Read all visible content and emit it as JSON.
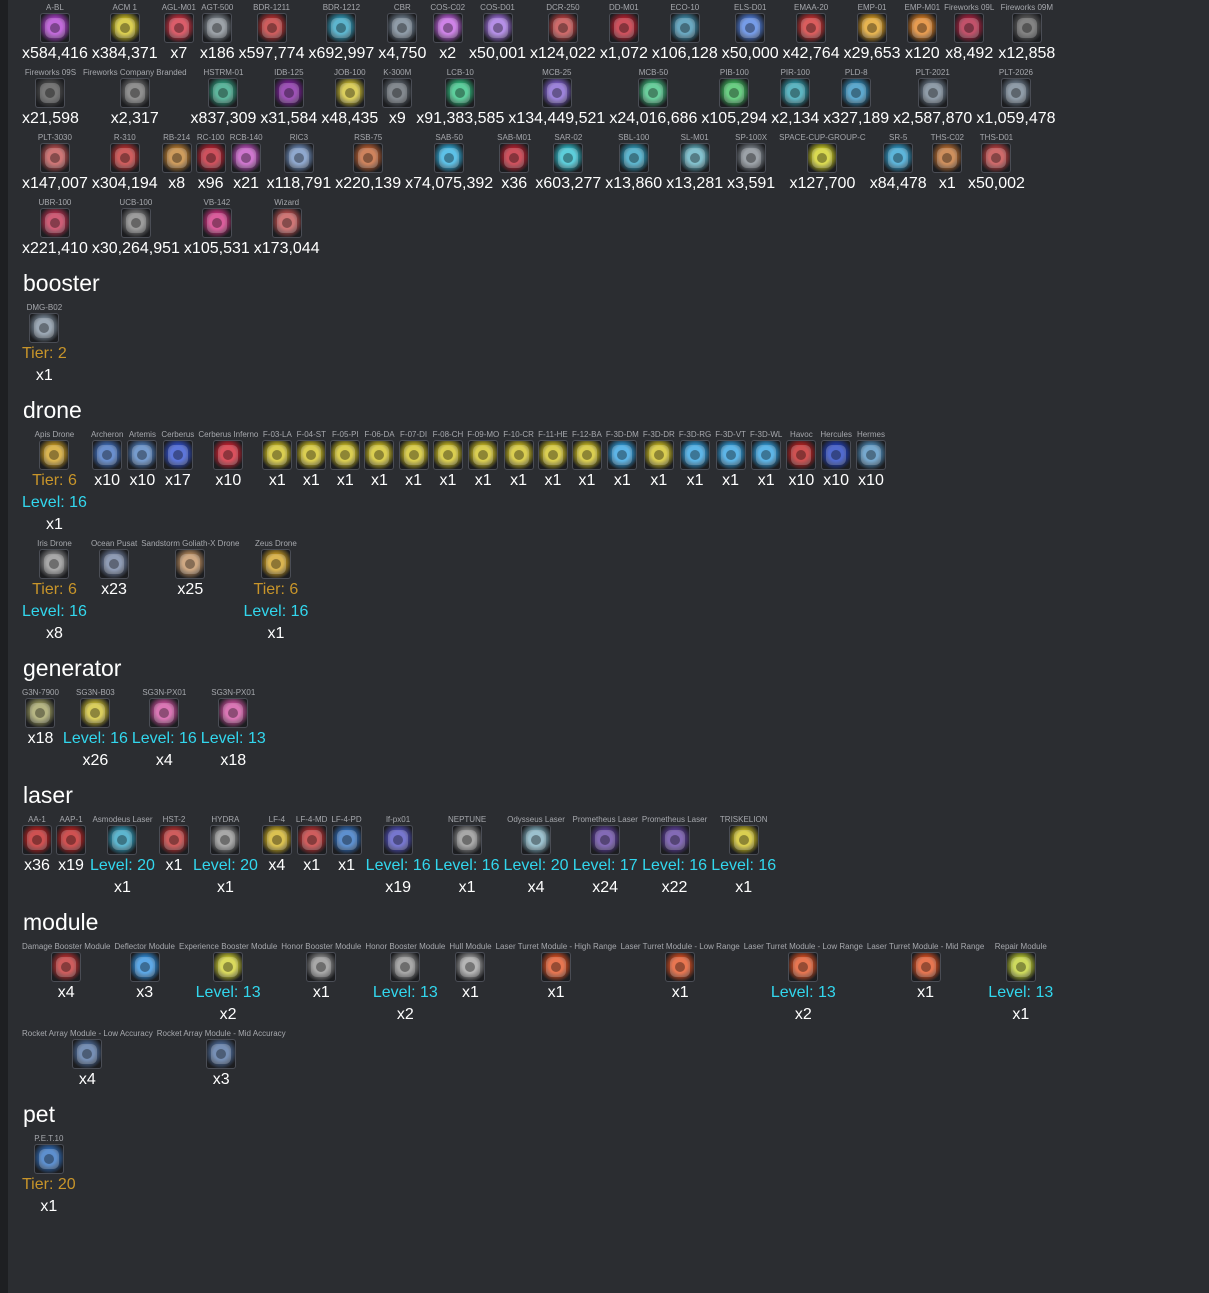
{
  "sections": [
    {
      "heading": "",
      "rows": [
        [
          {
            "name": "A-BL",
            "qty": "x584,416",
            "color": "#b040d0"
          },
          {
            "name": "ACM 1",
            "qty": "x384,371",
            "color": "#d0c020"
          },
          {
            "name": "AGL-M01",
            "qty": "x7",
            "color": "#d03040"
          },
          {
            "name": "AGT-500",
            "qty": "x186",
            "color": "#808890"
          },
          {
            "name": "BDR-1211",
            "qty": "x597,774",
            "color": "#c03030"
          },
          {
            "name": "BDR-1212",
            "qty": "x692,997",
            "color": "#30a0c0"
          },
          {
            "name": "CBR",
            "qty": "x4,750",
            "color": "#708090"
          },
          {
            "name": "COS-C02",
            "qty": "x2",
            "color": "#c060e0"
          },
          {
            "name": "COS-D01",
            "qty": "x50,001",
            "color": "#a070e0"
          },
          {
            "name": "DCR-250",
            "qty": "x124,022",
            "color": "#c04040"
          },
          {
            "name": "DD-M01",
            "qty": "x1,072",
            "color": "#c02030"
          },
          {
            "name": "ECO-10",
            "qty": "x106,128",
            "color": "#4090b0"
          },
          {
            "name": "ELS-D01",
            "qty": "x50,000",
            "color": "#5080e0"
          },
          {
            "name": "EMAA-20",
            "qty": "x42,764",
            "color": "#d03030"
          },
          {
            "name": "EMP-01",
            "qty": "x29,653",
            "color": "#e0a020"
          },
          {
            "name": "EMP-M01",
            "qty": "x120",
            "color": "#e08020"
          },
          {
            "name": "Fireworks 09L",
            "qty": "x8,492",
            "color": "#b02040"
          },
          {
            "name": "Fireworks 09M",
            "qty": "x12,858",
            "color": "#606060"
          }
        ],
        [
          {
            "name": "Fireworks 09S",
            "qty": "x21,598",
            "color": "#505050"
          },
          {
            "name": "Fireworks Company Branded",
            "qty": "x2,317",
            "color": "#707070"
          },
          {
            "name": "HSTRM-01",
            "qty": "x837,309",
            "color": "#30a080"
          },
          {
            "name": "IDB-125",
            "qty": "x31,584",
            "color": "#8020a0"
          },
          {
            "name": "JOB-100",
            "qty": "x48,435",
            "color": "#d0c030"
          },
          {
            "name": "K-300M",
            "qty": "x9",
            "color": "#606870"
          },
          {
            "name": "LCB-10",
            "qty": "x91,383,585",
            "color": "#30c080"
          },
          {
            "name": "MCB-25",
            "qty": "x134,449,521",
            "color": "#8060d0"
          },
          {
            "name": "MCB-50",
            "qty": "x24,016,686",
            "color": "#40c080"
          },
          {
            "name": "PIB-100",
            "qty": "x105,294",
            "color": "#40c060"
          },
          {
            "name": "PIR-100",
            "qty": "x2,134",
            "color": "#30a0b0"
          },
          {
            "name": "PLD-8",
            "qty": "x327,189",
            "color": "#3090c0"
          },
          {
            "name": "PLT-2021",
            "qty": "x2,587,870",
            "color": "#708090"
          },
          {
            "name": "PLT-2026",
            "qty": "x1,059,478",
            "color": "#708090"
          }
        ],
        [
          {
            "name": "PLT-3030",
            "qty": "x147,007",
            "color": "#c05050"
          },
          {
            "name": "R-310",
            "qty": "x304,194",
            "color": "#c03030"
          },
          {
            "name": "RB-214",
            "qty": "x8",
            "color": "#c08030"
          },
          {
            "name": "RC-100",
            "qty": "x96",
            "color": "#c02030"
          },
          {
            "name": "RCB-140",
            "qty": "x21",
            "color": "#c050c0"
          },
          {
            "name": "RIC3",
            "qty": "x118,791",
            "color": "#7090c0"
          },
          {
            "name": "RSB-75",
            "qty": "x220,139",
            "color": "#c06030"
          },
          {
            "name": "SAB-50",
            "qty": "x74,075,392",
            "color": "#30b0e0"
          },
          {
            "name": "SAB-M01",
            "qty": "x36",
            "color": "#c02030"
          },
          {
            "name": "SAR-02",
            "qty": "x603,277",
            "color": "#30c0d0"
          },
          {
            "name": "SBL-100",
            "qty": "x13,860",
            "color": "#30a0c0"
          },
          {
            "name": "SL-M01",
            "qty": "x13,281",
            "color": "#60b0c0"
          },
          {
            "name": "SP-100X",
            "qty": "x3,591",
            "color": "#808890"
          },
          {
            "name": "SPACE-CUP-GROUP-C",
            "qty": "x127,700",
            "color": "#d0d020"
          },
          {
            "name": "SR-5",
            "qty": "x84,478",
            "color": "#30a0d0"
          },
          {
            "name": "THS-C02",
            "qty": "x1",
            "color": "#c07030"
          },
          {
            "name": "THS-D01",
            "qty": "x50,002",
            "color": "#c04040"
          }
        ],
        [
          {
            "name": "UBR-100",
            "qty": "x221,410",
            "color": "#c03050"
          },
          {
            "name": "UCB-100",
            "qty": "x30,264,951",
            "color": "#808080"
          },
          {
            "name": "VB-142",
            "qty": "x105,531",
            "color": "#d03080"
          },
          {
            "name": "Wizard",
            "qty": "x173,044",
            "color": "#c05050"
          }
        ]
      ]
    },
    {
      "heading": "booster",
      "rows": [
        [
          {
            "name": "DMG-B02",
            "tier": "Tier: 2",
            "qty": "x1",
            "color": "#8090a0"
          }
        ]
      ]
    },
    {
      "heading": "drone",
      "rows": [
        [
          {
            "name": "Apis Drone",
            "tier": "Tier: 6",
            "level": "Level: 16",
            "qty": "x1",
            "color": "#d0a020"
          },
          {
            "name": "Archeron",
            "qty": "x10",
            "color": "#4070c0"
          },
          {
            "name": "Artemis",
            "qty": "x10",
            "color": "#5080c0"
          },
          {
            "name": "Cerberus",
            "qty": "x17",
            "color": "#3050d0"
          },
          {
            "name": "Cerberus Inferno",
            "qty": "x10",
            "color": "#d02030"
          },
          {
            "name": "F-03-LA",
            "qty": "x1",
            "color": "#d0c020"
          },
          {
            "name": "F-04-ST",
            "qty": "x1",
            "color": "#d0c020"
          },
          {
            "name": "F-05-PI",
            "qty": "x1",
            "color": "#d0c020"
          },
          {
            "name": "F-06-DA",
            "qty": "x1",
            "color": "#d0c020"
          },
          {
            "name": "F-07-DI",
            "qty": "x1",
            "color": "#d0c020"
          },
          {
            "name": "F-08-CH",
            "qty": "x1",
            "color": "#d0c020"
          },
          {
            "name": "F-09-MO",
            "qty": "x1",
            "color": "#d0c020"
          },
          {
            "name": "F-10-CR",
            "qty": "x1",
            "color": "#d0c020"
          },
          {
            "name": "F-11-HE",
            "qty": "x1",
            "color": "#d0c020"
          },
          {
            "name": "F-12-BA",
            "qty": "x1",
            "color": "#d0c020"
          },
          {
            "name": "F-3D-DM",
            "qty": "x1",
            "color": "#30a0e0"
          },
          {
            "name": "F-3D-DR",
            "qty": "x1",
            "color": "#d0c020"
          },
          {
            "name": "F-3D-RG",
            "qty": "x1",
            "color": "#30a0e0"
          },
          {
            "name": "F-3D-VT",
            "qty": "x1",
            "color": "#30a0e0"
          },
          {
            "name": "F-3D-WL",
            "qty": "x1",
            "color": "#30a0e0"
          },
          {
            "name": "Havoc",
            "qty": "x10",
            "color": "#c02020"
          },
          {
            "name": "Hercules",
            "qty": "x10",
            "color": "#2040c0"
          },
          {
            "name": "Hermes",
            "qty": "x10",
            "color": "#5090c0"
          }
        ],
        [
          {
            "name": "Iris Drone",
            "tier": "Tier: 6",
            "level": "Level: 16",
            "qty": "x8",
            "color": "#909090"
          },
          {
            "name": "Ocean Pusat",
            "qty": "x23",
            "color": "#7080a0"
          },
          {
            "name": "Sandstorm Goliath-X Drone",
            "qty": "x25",
            "color": "#c09060"
          },
          {
            "name": "Zeus Drone",
            "tier": "Tier: 6",
            "level": "Level: 16",
            "qty": "x1",
            "color": "#d0a020"
          }
        ]
      ]
    },
    {
      "heading": "generator",
      "rows": [
        [
          {
            "name": "G3N-7900",
            "qty": "x18",
            "color": "#a0a060"
          },
          {
            "name": "SG3N-B03",
            "level": "Level: 16",
            "qty": "x26",
            "color": "#d0c030"
          },
          {
            "name": "SG3N-PX01",
            "level": "Level: 16",
            "qty": "x4",
            "color": "#d050a0"
          },
          {
            "name": "SG3N-PX01",
            "level": "Level: 13",
            "qty": "x18",
            "color": "#d050a0"
          }
        ]
      ]
    },
    {
      "heading": "laser",
      "rows": [
        [
          {
            "name": "AA-1",
            "qty": "x36",
            "color": "#c02020"
          },
          {
            "name": "AAP-1",
            "qty": "x19",
            "color": "#c02020"
          },
          {
            "name": "Asmodeus Laser",
            "level": "Level: 20",
            "qty": "x1",
            "color": "#30a0c0"
          },
          {
            "name": "HST-2",
            "qty": "x1",
            "color": "#c03030"
          },
          {
            "name": "HYDRA",
            "level": "Level: 20",
            "qty": "x1",
            "color": "#909090"
          },
          {
            "name": "LF-4",
            "qty": "x4",
            "color": "#d0b020"
          },
          {
            "name": "LF-4-MD",
            "qty": "x1",
            "color": "#c03030"
          },
          {
            "name": "LF-4-PD",
            "qty": "x1",
            "color": "#3070c0"
          },
          {
            "name": "lf-px01",
            "level": "Level: 16",
            "qty": "x19",
            "color": "#5050c0"
          },
          {
            "name": "NEPTUNE",
            "level": "Level: 16",
            "qty": "x1",
            "color": "#909090"
          },
          {
            "name": "Odysseus Laser",
            "level": "Level: 20",
            "qty": "x4",
            "color": "#80b0c0"
          },
          {
            "name": "Prometheus Laser",
            "level": "Level: 17",
            "qty": "x24",
            "color": "#6040a0"
          },
          {
            "name": "Prometheus Laser",
            "level": "Level: 16",
            "qty": "x22",
            "color": "#6040a0"
          },
          {
            "name": "TRISKELION",
            "level": "Level: 16",
            "qty": "x1",
            "color": "#d0c020"
          }
        ]
      ]
    },
    {
      "heading": "module",
      "rows": [
        [
          {
            "name": "Damage Booster Module",
            "qty": "x4",
            "color": "#c03030"
          },
          {
            "name": "Deflector Module",
            "qty": "x3",
            "color": "#3090e0"
          },
          {
            "name": "Experience Booster Module",
            "level": "Level: 13",
            "qty": "x2",
            "color": "#d0d030"
          },
          {
            "name": "Honor Booster Module",
            "qty": "x1",
            "color": "#909090"
          },
          {
            "name": "Honor Booster Module",
            "level": "Level: 13",
            "qty": "x2",
            "color": "#909090"
          },
          {
            "name": "Hull Module",
            "qty": "x1",
            "color": "#a0a0a0"
          },
          {
            "name": "Laser Turret Module - High Range",
            "qty": "x1",
            "color": "#e05020"
          },
          {
            "name": "Laser Turret Module - Low Range",
            "qty": "x1",
            "color": "#e05020"
          },
          {
            "name": "Laser Turret Module - Low Range",
            "level": "Level: 13",
            "qty": "x2",
            "color": "#e05020"
          },
          {
            "name": "Laser Turret Module - Mid Range",
            "qty": "x1",
            "color": "#e05020"
          },
          {
            "name": "Repair Module",
            "level": "Level: 13",
            "qty": "x1",
            "color": "#c0d030"
          }
        ],
        [
          {
            "name": "Rocket Array Module - Low Accuracy",
            "qty": "x4",
            "color": "#5070a0"
          },
          {
            "name": "Rocket Array Module - Mid Accuracy",
            "qty": "x3",
            "color": "#5070a0"
          }
        ]
      ]
    },
    {
      "heading": "pet",
      "rows": [
        [
          {
            "name": "P.E.T.10",
            "tier": "Tier: 20",
            "qty": "x1",
            "color": "#3070c0"
          }
        ]
      ]
    }
  ]
}
